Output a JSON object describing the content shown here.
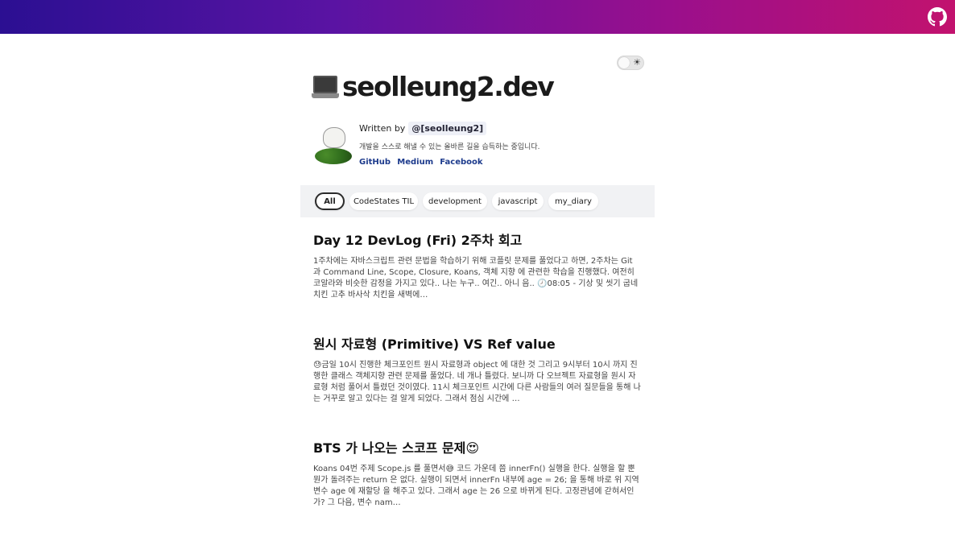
{
  "header": {
    "github_icon": "github-icon",
    "gradient": [
      "#2b0f92",
      "#c2126e"
    ]
  },
  "theme_toggle": {
    "icon": "sun-icon"
  },
  "site": {
    "title": "seolleung2.dev",
    "icon": "laptop-icon"
  },
  "bio": {
    "written_by": "Written by",
    "handle": "@[seolleung2]",
    "description": "개발을 스스로 해낼 수 있는 올바른 길을 습득하는 중입니다.",
    "links": [
      "GitHub",
      "Medium",
      "Facebook"
    ]
  },
  "tabs": [
    {
      "label": "All",
      "active": true
    },
    {
      "label": "CodeStates TIL",
      "active": false
    },
    {
      "label": "development",
      "active": false
    },
    {
      "label": "javascript",
      "active": false
    },
    {
      "label": "my_diary",
      "active": false
    }
  ],
  "posts": [
    {
      "title": "Day 12 DevLog (Fri) 2주차 회고",
      "excerpt": "1주차에는 자바스크립트 관련 문법을 학습하기 위해 코플릿 문제를 풀었다고 하면, 2주차는 Git 과 Command Line, Scope, Closure, Koans, 객체 지향 에 관련한 학습을 진행했다. 여전히 코알라와 비슷한 감정을 가지고 있다.. 나는 누구.. 여긴.. 아니 음.. 🕗08:05 - 기상 및 씻기 굽네 치킨 고추 바사삭 치킨을 새벽에…"
    },
    {
      "title": "원시 자료형 (Primitive) VS Ref value",
      "excerpt": "😓금일 10시 진행한 체크포인트 원시 자료형과 object 에 대한 것 그리고 9시부터 10시 까지 진행한 클래스 객체지향 관련 문제를 풀었다. 네 개나 틀렸다. 보니까 다 오브젝트 자료형을 원시 자료형 처럼 풀어서 틀렸던 것이였다. 11시 체크포인트 시간에 다른 사람들의 여러 질문들을 통해 나는 거꾸로 알고 있다는 걸 알게 되었다. 그래서 점심 시간에 …"
    },
    {
      "title": "BTS 가 나오는 스코프 문제😍",
      "excerpt": "Koans 04번 주제 Scope.js 를 풀면서😅 코드 가운데 쯤 innerFn() 실행을 한다. 실행을 할 뿐 뭔가 돌려주는 return 은 없다. 실행이 되면서 innerFn 내부에 age = 26; 을 통해 바로 위 지역변수 age 에 재할당 을 해주고 있다. 그래서 age 는 26 으로 바뀌게 된다. 고정관념에 갇혀서인가? 그 다음, 변수 nam…"
    }
  ]
}
